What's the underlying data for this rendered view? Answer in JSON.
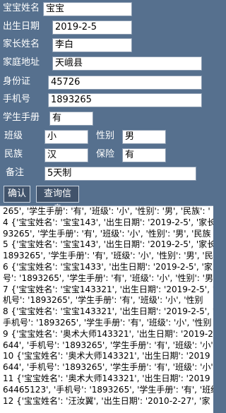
{
  "form": {
    "baby_name": {
      "label": "宝宝姓名",
      "value": "宝宝"
    },
    "birth_date": {
      "label": "出生日期",
      "value": "2019-2-5"
    },
    "parent_name": {
      "label": "家长姓名",
      "value": "李白"
    },
    "address": {
      "label": "家庭地址",
      "value": "天峨县"
    },
    "id_card": {
      "label": "身份证",
      "value": "45726"
    },
    "phone": {
      "label": "手机号",
      "value": "1893265"
    },
    "handbook": {
      "label": "学生手册",
      "value": "有"
    },
    "class": {
      "label": "班级",
      "value": "小"
    },
    "gender": {
      "label": "性别",
      "value": "男"
    },
    "ethnicity": {
      "label": "民族",
      "value": "汉"
    },
    "insurance": {
      "label": "保险",
      "value": "有"
    },
    "note": {
      "label": "备注",
      "value": "5天制"
    }
  },
  "buttons": {
    "confirm": "确认",
    "query": "查询信息"
  },
  "log_lines": [
    "265', '学生手册': '有', '班级': '小', '性别': '男', '民族': '",
    "4 {'宝宝姓名': '宝宝143', '出生日期': '2019-2-5', '家长",
    "93265', '学生手册': '有', '班级': '小', '性别': '男', '民族",
    "5 {'宝宝姓名': '宝宝143', '出生日期': '2019-2-5', '家长",
    "1893265', '学生手册': '有', '班级': '小', '性别': '男', '民",
    "6 {'宝宝姓名': '宝宝1433', '出生日期': '2019-2-5', '家",
    "号': '1893265', '学生手册': '有', '班级': '小', '性别': '男",
    "7 {'宝宝姓名': '宝宝143321', '出生日期': '2019-2-5', '",
    "机号': '1893265', '学生手册': '有', '班级': '小', '性别",
    "8 {'宝宝姓名': '宝宝143321', '出生日期': '2019-2-5', '",
    "手机号': '1893265', '学生手册': '有', '班级': '小', '性别",
    "9 {'宝宝姓名': '奥术大师143321', '出生日期': '2019-2",
    "644', '手机号': '1893265', '学生手册': '有', '班级': '小'",
    "10 {'宝宝姓名': '奥术大师143321', '出生日期': '2019",
    "644', '手机号': '1893265', '学生手册': '有', '班级': '小'",
    "11 {'宝宝姓名': '奥术大师143321', '出生日期': '2019",
    "64465123', '手机号': '1893265', '学生手册': '有', '班级",
    "12 {'宝宝姓名': '汪汝翼', '出生日期': '2010-2-27', '家"
  ]
}
